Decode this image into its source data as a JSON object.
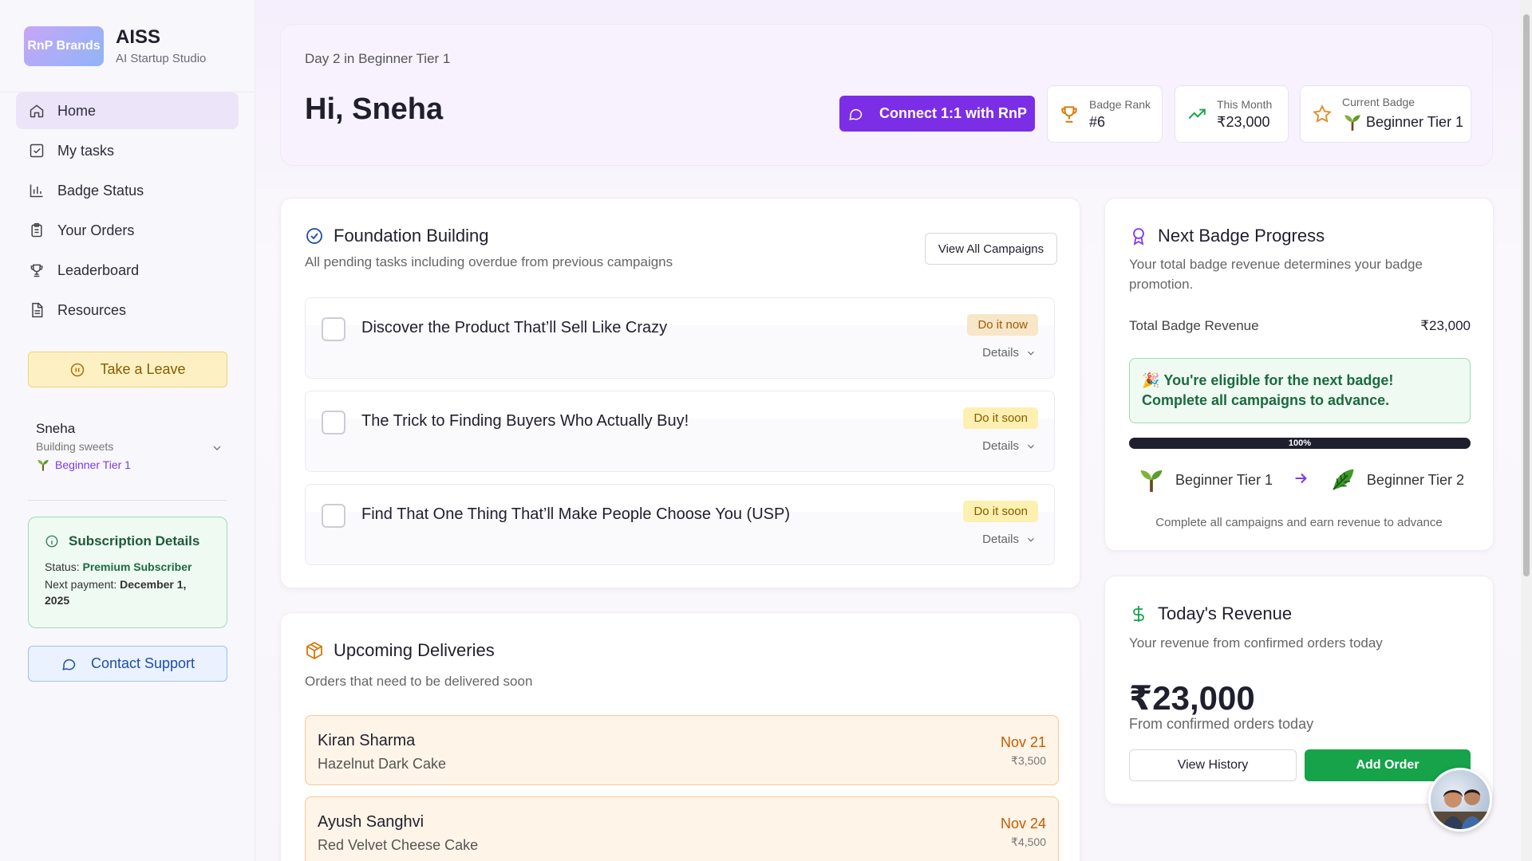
{
  "brand": {
    "logo_text": "RnP Brands",
    "title": "AISS",
    "subtitle": "AI Startup Studio"
  },
  "nav": {
    "items": [
      {
        "label": "Home",
        "icon": "home-icon",
        "active": true
      },
      {
        "label": "My tasks",
        "icon": "checkbox-icon"
      },
      {
        "label": "Badge Status",
        "icon": "bar-chart-icon"
      },
      {
        "label": "Your Orders",
        "icon": "clipboard-icon"
      },
      {
        "label": "Leaderboard",
        "icon": "trophy-icon"
      },
      {
        "label": "Resources",
        "icon": "file-icon"
      }
    ]
  },
  "sidebar": {
    "leave_label": "Take a Leave",
    "user": {
      "name": "Sneha",
      "business": "Building sweets",
      "tier": "Beginner Tier 1"
    },
    "subscription": {
      "title": "Subscription Details",
      "status_label": "Status:",
      "status_value": "Premium Subscriber",
      "payment_label": "Next payment:",
      "payment_value": "December 1, 2025"
    },
    "support_label": "Contact Support"
  },
  "hero": {
    "day_text": "Day 2 in Beginner Tier 1",
    "greeting": "Hi, Sneha",
    "connect_label": "Connect 1:1 with RnP",
    "stats": {
      "rank_label": "Badge Rank",
      "rank_value": "#6",
      "month_label": "This Month",
      "month_value": "₹23,000",
      "badge_label": "Current Badge",
      "badge_value": "Beginner Tier 1"
    }
  },
  "foundation": {
    "title": "Foundation Building",
    "subtitle": "All pending tasks including overdue from previous campaigns",
    "view_all_label": "View All Campaigns",
    "details_label": "Details",
    "tasks": [
      {
        "title": "Discover the Product That’ll Sell Like Crazy",
        "badge": "Do it now"
      },
      {
        "title": "The Trick to Finding Buyers Who Actually Buy!",
        "badge": "Do it soon"
      },
      {
        "title": "Find That One Thing That’ll Make People Choose You (USP)",
        "badge": "Do it soon"
      }
    ]
  },
  "deliveries": {
    "title": "Upcoming Deliveries",
    "subtitle": "Orders that need to be delivered soon",
    "items": [
      {
        "name": "Kiran Sharma",
        "item": "Hazelnut Dark Cake",
        "date": "Nov 21",
        "amount": "₹3,500"
      },
      {
        "name": "Ayush Sanghvi",
        "item": "Red Velvet Cheese Cake",
        "date": "Nov 24",
        "amount": "₹4,500"
      }
    ]
  },
  "badge_progress": {
    "title": "Next Badge Progress",
    "subtitle": "Your total badge revenue determines your badge promotion.",
    "revenue_label": "Total Badge Revenue",
    "revenue_value": "₹23,000",
    "eligible_text": "You're eligible for the next badge! Complete all campaigns to advance.",
    "progress_text": "100%",
    "progress_value": 100,
    "from_tier": "Beginner Tier 1",
    "to_tier": "Beginner Tier 2",
    "note": "Complete all campaigns and earn revenue to advance"
  },
  "todays_revenue": {
    "title": "Today's Revenue",
    "subtitle": "Your revenue from confirmed orders today",
    "amount": "₹23,000",
    "amount_sub": "From confirmed orders today",
    "history_label": "View History",
    "add_label": "Add Order"
  },
  "colors": {
    "accent": "#7c2ee6",
    "success": "#16a34a",
    "warning": "#c45a00"
  }
}
